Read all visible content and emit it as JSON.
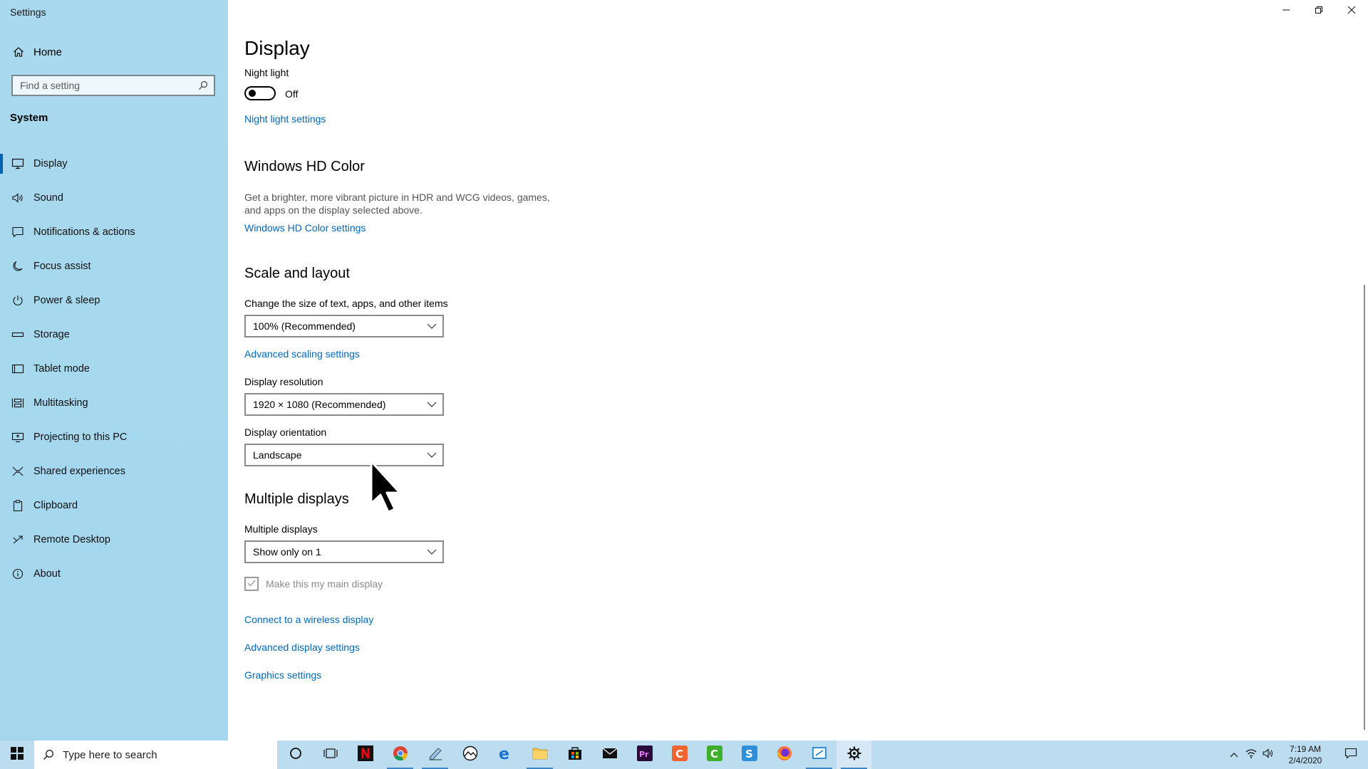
{
  "window": {
    "title": "Settings"
  },
  "sidebar": {
    "home_label": "Home",
    "search_placeholder": "Find a setting",
    "section": "System",
    "items": [
      {
        "label": "Display",
        "icon": "monitor-icon",
        "active": true
      },
      {
        "label": "Sound",
        "icon": "speaker-icon"
      },
      {
        "label": "Notifications & actions",
        "icon": "notification-icon"
      },
      {
        "label": "Focus assist",
        "icon": "moon-icon"
      },
      {
        "label": "Power & sleep",
        "icon": "power-icon"
      },
      {
        "label": "Storage",
        "icon": "storage-icon"
      },
      {
        "label": "Tablet mode",
        "icon": "tablet-icon"
      },
      {
        "label": "Multitasking",
        "icon": "multitasking-icon"
      },
      {
        "label": "Projecting to this PC",
        "icon": "projector-icon"
      },
      {
        "label": "Shared experiences",
        "icon": "shared-icon"
      },
      {
        "label": "Clipboard",
        "icon": "clipboard-icon"
      },
      {
        "label": "Remote Desktop",
        "icon": "remote-desktop-icon"
      },
      {
        "label": "About",
        "icon": "info-icon"
      }
    ]
  },
  "main": {
    "title": "Display",
    "night_light": {
      "label": "Night light",
      "state": "Off",
      "settings_link": "Night light settings"
    },
    "hd_color": {
      "heading": "Windows HD Color",
      "description": "Get a brighter, more vibrant picture in HDR and WCG videos, games, and apps on the display selected above.",
      "link": "Windows HD Color settings"
    },
    "scale_layout": {
      "heading": "Scale and layout",
      "scale_label": "Change the size of text, apps, and other items",
      "scale_value": "100% (Recommended)",
      "advanced_link": "Advanced scaling settings",
      "resolution_label": "Display resolution",
      "resolution_value": "1920 × 1080 (Recommended)",
      "orientation_label": "Display orientation",
      "orientation_value": "Landscape"
    },
    "multiple_displays": {
      "heading": "Multiple displays",
      "label": "Multiple displays",
      "value": "Show only on 1",
      "checkbox_label": "Make this my main display",
      "links": [
        "Connect to a wireless display",
        "Advanced display settings",
        "Graphics settings"
      ]
    }
  },
  "taskbar": {
    "search_placeholder": "Type here to search",
    "time": "7:19 AM",
    "date": "2/4/2020"
  },
  "colors": {
    "accent": "#0063b1",
    "link": "#0067b8",
    "sidebar_bg": "#a6d8ee",
    "taskbar_bg": "#bcdcf0"
  }
}
